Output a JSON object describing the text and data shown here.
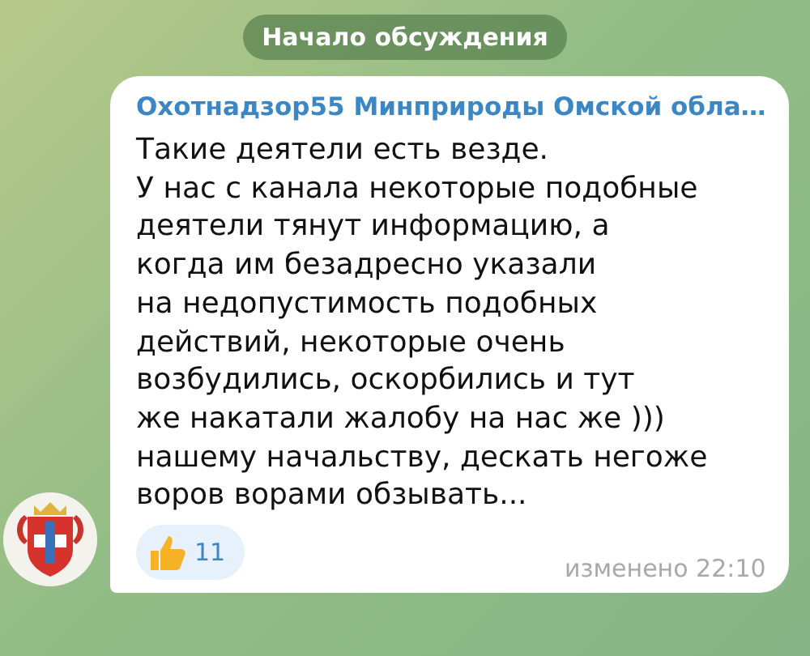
{
  "service_message": "Начало обсуждения",
  "message": {
    "sender": "Охотнадзор55 Минприроды Омской обла…",
    "lines": [
      "Такие деятели есть везде.",
      "У нас с канала некоторые подобные",
      "деятели тянут информацию, а",
      "когда им безадресно указали",
      "на недопустимость подобных",
      "действий, некоторые очень",
      "возбудились, оскорбились и тут",
      "же накатали жалобу на нас же )))",
      "нашему начальству, дескать негоже",
      "воров ворами обзывать..."
    ],
    "reactions": [
      {
        "count": "11",
        "selected": false
      }
    ],
    "edited_time": "изменено 22:10"
  }
}
